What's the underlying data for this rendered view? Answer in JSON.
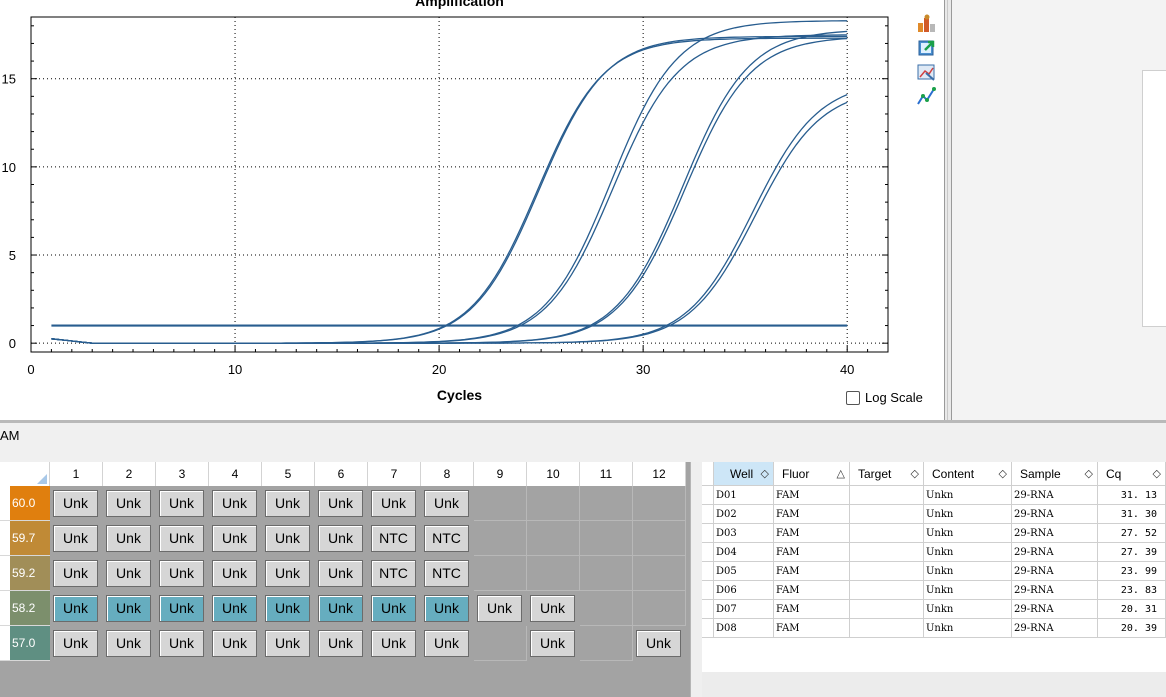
{
  "chart_data": {
    "type": "line",
    "title": "Amplification",
    "xlabel": "Cycles",
    "ylabel": "",
    "xlim": [
      0,
      42
    ],
    "ylim": [
      -0.5,
      18.5
    ],
    "x_ticks": [
      "0",
      "10",
      "20",
      "30",
      "40"
    ],
    "y_ticks": [
      "0",
      "5",
      "10",
      "15"
    ],
    "line_color": "#285d8f",
    "threshold": 1.0,
    "grid": true,
    "series": [
      {
        "well": "D01",
        "cq": 31.13,
        "plateau": 14.9
      },
      {
        "well": "D02",
        "cq": 31.3,
        "plateau": 14.5
      },
      {
        "well": "D03",
        "cq": 27.52,
        "plateau": 17.4
      },
      {
        "well": "D04",
        "cq": 27.39,
        "plateau": 17.8
      },
      {
        "well": "D05",
        "cq": 23.99,
        "plateau": 17.5
      },
      {
        "well": "D06",
        "cq": 23.83,
        "plateau": 18.3
      },
      {
        "well": "D07",
        "cq": 20.31,
        "plateau": 17.3
      },
      {
        "well": "D08",
        "cq": 20.39,
        "plateau": 17.4
      }
    ]
  },
  "chart": {
    "log_scale_label": "Log Scale",
    "log_scale_checked": false
  },
  "toolbar": {
    "icons": [
      "copy-icon",
      "chart-settings-icon",
      "export-icon",
      "zoom-icon",
      "trace-styles-icon"
    ]
  },
  "fluor_selector": {
    "label": "AM"
  },
  "plate": {
    "columns": [
      "1",
      "2",
      "3",
      "4",
      "5",
      "6",
      "7",
      "8",
      "9",
      "10",
      "11",
      "12"
    ],
    "rows": [
      {
        "temp": "60.0",
        "color": "#e07f0e",
        "wells": [
          "Unk",
          "Unk",
          "Unk",
          "Unk",
          "Unk",
          "Unk",
          "Unk",
          "Unk",
          "",
          "",
          "",
          ""
        ],
        "teal": false
      },
      {
        "temp": "59.7",
        "color": "#c08a36",
        "wells": [
          "Unk",
          "Unk",
          "Unk",
          "Unk",
          "Unk",
          "Unk",
          "NTC",
          "NTC",
          "",
          "",
          "",
          ""
        ],
        "teal": false
      },
      {
        "temp": "59.2",
        "color": "#a18e58",
        "wells": [
          "Unk",
          "Unk",
          "Unk",
          "Unk",
          "Unk",
          "Unk",
          "NTC",
          "NTC",
          "",
          "",
          "",
          ""
        ],
        "teal": false
      },
      {
        "temp": "58.2",
        "color": "#7c8f6c",
        "wells": [
          "Unk",
          "Unk",
          "Unk",
          "Unk",
          "Unk",
          "Unk",
          "Unk",
          "Unk",
          "Unk",
          "Unk",
          "",
          ""
        ],
        "teal": true
      },
      {
        "temp": "57.0",
        "color": "#5f8f82",
        "wells": [
          "Unk",
          "Unk",
          "Unk",
          "Unk",
          "Unk",
          "Unk",
          "Unk",
          "Unk",
          "",
          "Unk",
          "",
          "Unk"
        ],
        "teal": false
      }
    ]
  },
  "table": {
    "columns": [
      {
        "label": "Well",
        "sort": "◇"
      },
      {
        "label": "Fluor",
        "sort": "△"
      },
      {
        "label": "Target",
        "sort": "◇"
      },
      {
        "label": "Content",
        "sort": "◇"
      },
      {
        "label": "Sample",
        "sort": "◇"
      },
      {
        "label": "Cq",
        "sort": "◇"
      }
    ],
    "rows": [
      {
        "well": "D01",
        "fluor": "FAM",
        "target": "",
        "content": "Unkn",
        "sample": "29-RNA",
        "cq": "31. 13"
      },
      {
        "well": "D02",
        "fluor": "FAM",
        "target": "",
        "content": "Unkn",
        "sample": "29-RNA",
        "cq": "31. 30"
      },
      {
        "well": "D03",
        "fluor": "FAM",
        "target": "",
        "content": "Unkn",
        "sample": "29-RNA",
        "cq": "27. 52"
      },
      {
        "well": "D04",
        "fluor": "FAM",
        "target": "",
        "content": "Unkn",
        "sample": "29-RNA",
        "cq": "27. 39"
      },
      {
        "well": "D05",
        "fluor": "FAM",
        "target": "",
        "content": "Unkn",
        "sample": "29-RNA",
        "cq": "23. 99"
      },
      {
        "well": "D06",
        "fluor": "FAM",
        "target": "",
        "content": "Unkn",
        "sample": "29-RNA",
        "cq": "23. 83"
      },
      {
        "well": "D07",
        "fluor": "FAM",
        "target": "",
        "content": "Unkn",
        "sample": "29-RNA",
        "cq": "20. 31"
      },
      {
        "well": "D08",
        "fluor": "FAM",
        "target": "",
        "content": "Unkn",
        "sample": "29-RNA",
        "cq": "20. 39"
      }
    ]
  }
}
